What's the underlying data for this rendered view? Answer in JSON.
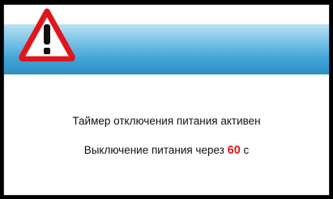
{
  "dialog": {
    "icon": "warning-triangle-icon",
    "line1": "Таймер отключения питания активен",
    "line2_prefix": "Выключение питания через",
    "countdown": "60",
    "line2_suffix": "с"
  },
  "colors": {
    "header_gradient_top": "#b9e2f4",
    "header_gradient_bottom": "#2f8fc4",
    "countdown": "#e0161e",
    "warning_triangle": "#e0161e"
  }
}
